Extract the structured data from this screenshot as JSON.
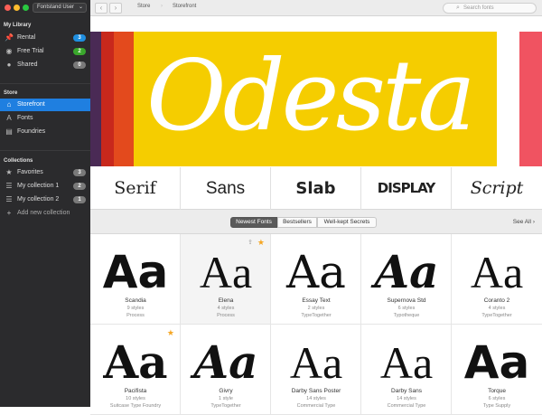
{
  "user_menu": {
    "label": "Fontstand User"
  },
  "sidebar": {
    "library_heading": "My Library",
    "library": [
      {
        "label": "Rental",
        "icon": "pin-icon",
        "badge": "3",
        "badge_color": "#1f8fe0"
      },
      {
        "label": "Free Trial",
        "icon": "eye-icon",
        "badge": "2",
        "badge_color": "#3aa82c"
      },
      {
        "label": "Shared",
        "icon": "person-icon",
        "badge": "0",
        "badge_color": "#7a7a7a"
      }
    ],
    "store_heading": "Store",
    "store": [
      {
        "label": "Storefront",
        "icon": "home-icon",
        "active": true
      },
      {
        "label": "Fonts",
        "icon": "font-icon"
      },
      {
        "label": "Foundries",
        "icon": "building-icon"
      }
    ],
    "collections_heading": "Collections",
    "collections": [
      {
        "label": "Favorites",
        "icon": "star-icon",
        "badge": "3"
      },
      {
        "label": "My collection 1",
        "icon": "list-icon",
        "badge": "2"
      },
      {
        "label": "My collection 2",
        "icon": "list-icon",
        "badge": "1"
      }
    ],
    "add_collection": "Add new collection"
  },
  "toolbar": {
    "breadcrumbs": [
      "Store",
      "Storefront"
    ],
    "search_placeholder": "Search fonts"
  },
  "banner": {
    "text": "Odesta"
  },
  "categories": [
    "Serif",
    "Sans",
    "Slab",
    "DISPLAY",
    "Script"
  ],
  "filters": {
    "tabs": [
      "Newest Fonts",
      "Bestsellers",
      "Well-kept Secrets"
    ],
    "active": "Newest Fonts",
    "see_all": "See All"
  },
  "fonts": [
    {
      "specimen": "Aa",
      "name": "Scandia",
      "styles": "9 styles",
      "foundry": "Process"
    },
    {
      "specimen": "Aa",
      "name": "Elena",
      "styles": "4 styles",
      "foundry": "Process",
      "favorite": true
    },
    {
      "specimen": "Aa",
      "name": "Essay Text",
      "styles": "2 styles",
      "foundry": "TypeTogether"
    },
    {
      "specimen": "Aa",
      "name": "Supernova Std",
      "styles": "6 styles",
      "foundry": "Typotheque"
    },
    {
      "specimen": "Aa",
      "name": "Coranto 2",
      "styles": "4 styles",
      "foundry": "TypeTogether"
    },
    {
      "specimen": "Aa",
      "name": "Pacifista",
      "styles": "10 styles",
      "foundry": "Suitcase Type Foundry",
      "favorite": true
    },
    {
      "specimen": "Aa",
      "name": "Givry",
      "styles": "1 style",
      "foundry": "TypeTogether"
    },
    {
      "specimen": "Aa",
      "name": "Darby Sans Poster",
      "styles": "14 styles",
      "foundry": "Commercial Type"
    },
    {
      "specimen": "Aa",
      "name": "Darby Sans",
      "styles": "14 styles",
      "foundry": "Commercial Type"
    },
    {
      "specimen": "Aa",
      "name": "Torque",
      "styles": "6 styles",
      "foundry": "Type Supply"
    }
  ]
}
